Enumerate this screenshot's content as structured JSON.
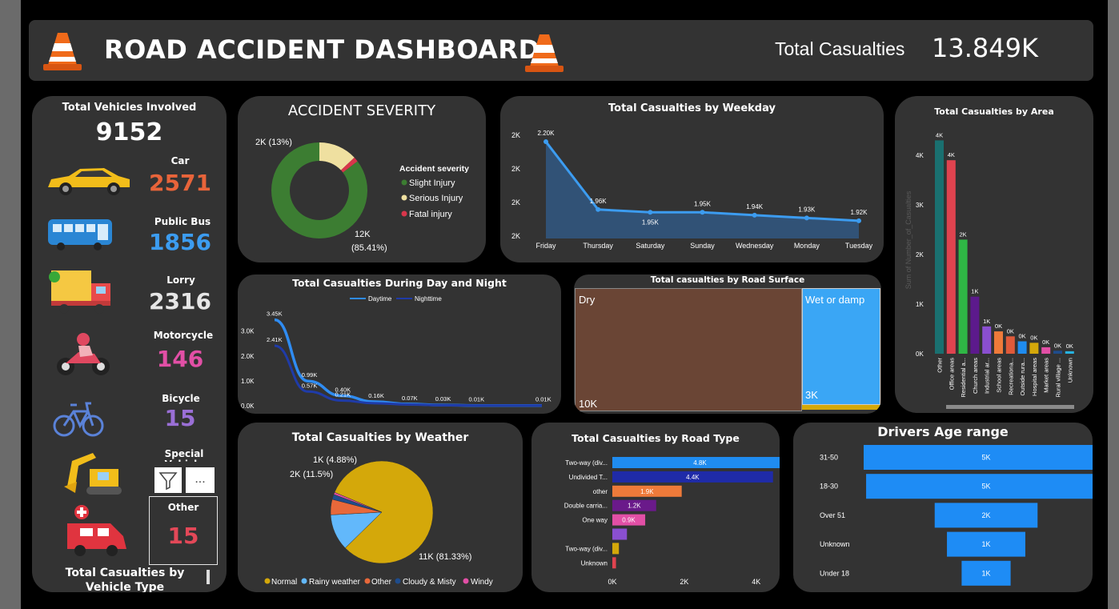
{
  "header": {
    "title": "ROAD ACCIDENT DASHBOARD",
    "kpi_label": "Total Casualties",
    "kpi_value": "13.849K"
  },
  "vehicles": {
    "title": "Total Vehicles Involved",
    "total": "9152",
    "items": [
      {
        "label": "Car",
        "value": "2571",
        "color": "#e8643a"
      },
      {
        "label": "Public Bus",
        "value": "1856",
        "color": "#3c9cf0"
      },
      {
        "label": "Lorry",
        "value": "2316",
        "color": "#e6e6e6"
      },
      {
        "label": "Motorcycle",
        "value": "146",
        "color": "#e24fa6"
      },
      {
        "label": "Bicycle",
        "value": "15",
        "color": "#9a6fd6"
      },
      {
        "label": "Special Vehicle",
        "value": ""
      },
      {
        "label": "Other",
        "value": "15",
        "color": "#e34858"
      }
    ],
    "footer": "Total Casualties by Vehicle Type"
  },
  "severity": {
    "title": "ACCIDENT SEVERITY",
    "legend_title": "Accident severity",
    "legend": [
      {
        "name": "Slight Injury",
        "color": "#3c7d32"
      },
      {
        "name": "Serious Injury",
        "color": "#efe0a0"
      },
      {
        "name": "Fatal injury",
        "color": "#d8364b"
      }
    ],
    "label_serious": "2K (13%)",
    "label_slight_1": "12K",
    "label_slight_2": "(85.41%)"
  },
  "weekday": {
    "title": "Total Casualties by Weekday"
  },
  "area": {
    "title": "Total Casualties by Area",
    "ylabel": "Sum of Number_of_Casualties"
  },
  "daynight": {
    "title": "Total Casualties During Day and Night",
    "legend": [
      "Daytime",
      "Nighttime"
    ]
  },
  "surface": {
    "title": "Total casualties by Road Surface",
    "dry_label": "Dry",
    "dry_value": "10K",
    "wet_label": "Wet or damp",
    "wet_value": "3K"
  },
  "weather": {
    "title": "Total Casualties by Weather",
    "label_normal": "11K (81.33%)",
    "label_rainy": "2K (11.5%)",
    "label_other": "1K (4.88%)",
    "legend": [
      {
        "name": "Normal",
        "color": "#d4a80a"
      },
      {
        "name": "Rainy weather",
        "color": "#62b8fb"
      },
      {
        "name": "Other",
        "color": "#e8683a"
      },
      {
        "name": "Cloudy & Misty",
        "color": "#1f4c8c"
      },
      {
        "name": "Windy",
        "color": "#e24fa6"
      }
    ]
  },
  "roadtype": {
    "title": "Total Casualties by Road Type"
  },
  "age": {
    "title": "Drivers Age range"
  },
  "toolbar": {
    "filter": "filter-icon",
    "more": "..."
  },
  "chart_data": [
    {
      "type": "area",
      "title": "Total Casualties by Weekday",
      "categories": [
        "Friday",
        "Thursday",
        "Saturday",
        "Sunday",
        "Wednesday",
        "Monday",
        "Tuesday"
      ],
      "values": [
        2.2,
        1.96,
        1.95,
        1.95,
        1.94,
        1.93,
        1.92
      ],
      "data_labels": [
        "2.20K",
        "1.96K",
        "1.95K",
        "1.95K",
        "1.94K",
        "1.93K",
        "1.92K"
      ],
      "ytick_labels": [
        "2K",
        "2K",
        "2K",
        "2K"
      ],
      "color": "#3c9cf0"
    },
    {
      "type": "bar",
      "title": "Total Casualties by Area",
      "categories": [
        "Other",
        "Office areas",
        "Residential a...",
        "Church areas",
        "Industrial ar...",
        "School areas",
        "Recreationa...",
        "Outside rura...",
        "Hospital areas",
        "Market areas",
        "Rural village ...",
        "Unknown"
      ],
      "values": [
        4.3,
        3.9,
        2.3,
        1.15,
        0.55,
        0.45,
        0.35,
        0.25,
        0.22,
        0.13,
        0.06,
        0.05
      ],
      "data_labels": [
        "4K",
        "4K",
        "2K",
        "1K",
        "1K",
        "0K",
        "0K",
        "0K",
        "0K",
        "0K",
        "0K",
        "0K"
      ],
      "colors": [
        "#1a7070",
        "#e0434f",
        "#2fb745",
        "#5c1a8c",
        "#8a4fd0",
        "#ee7a3a",
        "#e05a3a",
        "#1f8cf0",
        "#d4a80a",
        "#e24fa6",
        "#1f4c8c",
        "#27b3e0",
        "#8a4fd0"
      ],
      "yticks": [
        "0K",
        "1K",
        "2K",
        "3K",
        "4K"
      ],
      "ylim": [
        0,
        4.5
      ]
    },
    {
      "type": "line",
      "title": "Total Casualties During Day and Night",
      "x_count": 9,
      "series": [
        {
          "name": "Daytime",
          "values": [
            3.45,
            0.99,
            0.4,
            0.16,
            0.07,
            0.03,
            0.01,
            0.01,
            0.01
          ],
          "color": "#2f8cf2"
        },
        {
          "name": "Nighttime",
          "values": [
            2.41,
            0.57,
            0.21,
            0.1,
            0.05,
            0.02,
            0.01,
            0.01,
            0.01
          ],
          "color": "#1f3ba8"
        }
      ],
      "data_labels": [
        {
          "text": "3.45K",
          "i": 0,
          "v": 3.45
        },
        {
          "text": "2.41K",
          "i": 0,
          "v": 2.41
        },
        {
          "text": "0.99K",
          "i": 1,
          "v": 0.99
        },
        {
          "text": "0.57K",
          "i": 1,
          "v": 0.57
        },
        {
          "text": "0.40K",
          "i": 2,
          "v": 0.4
        },
        {
          "text": "0.21K",
          "i": 2,
          "v": 0.21
        },
        {
          "text": "0.16K",
          "i": 3,
          "v": 0.16
        },
        {
          "text": "0.07K",
          "i": 4,
          "v": 0.07
        },
        {
          "text": "0.03K",
          "i": 5,
          "v": 0.03
        },
        {
          "text": "0.01K",
          "i": 6,
          "v": 0.01
        },
        {
          "text": "0.01K",
          "i": 8,
          "v": 0.01
        }
      ],
      "yticks": [
        "0.0K",
        "1.0K",
        "2.0K",
        "3.0K"
      ],
      "ylim": [
        0,
        3.6
      ]
    },
    {
      "type": "pie",
      "title": "Total Casualties by Weather",
      "labels": [
        "Normal",
        "Rainy weather",
        "Other",
        "Cloudy & Misty",
        "Windy"
      ],
      "values": [
        81.33,
        11.5,
        4.88,
        1.6,
        0.69
      ],
      "colors": [
        "#d4a80a",
        "#62b8fb",
        "#e8683a",
        "#1f4c8c",
        "#e24fa6"
      ]
    },
    {
      "type": "donut",
      "title": "ACCIDENT SEVERITY",
      "labels": [
        "Slight Injury",
        "Serious Injury",
        "Fatal injury"
      ],
      "values": [
        85.41,
        13.0,
        1.59
      ],
      "colors": [
        "#3c7d32",
        "#efe0a0",
        "#d8364b"
      ]
    },
    {
      "type": "bar",
      "title": "Total Casualties by Road Type",
      "orientation": "horizontal",
      "categories": [
        "Two-way (div...",
        "Undivided T...",
        "other",
        "Double carria...",
        "One way",
        "",
        "Two-way (div...",
        "Unknown"
      ],
      "values": [
        4.8,
        4.4,
        1.9,
        1.2,
        0.9,
        0.4,
        0.18,
        0.1
      ],
      "data_labels": [
        "4.8K",
        "4.4K",
        "1.9K",
        "1.2K",
        "0.9K",
        "",
        "",
        ""
      ],
      "colors": [
        "#1f8cf0",
        "#1f2ba8",
        "#ee7a3a",
        "#6a1a8a",
        "#e24fa6",
        "#8a4fd0",
        "#d4a80a",
        "#e0434f"
      ],
      "xticks": [
        "0K",
        "2K",
        "4K"
      ],
      "xlim": [
        0,
        5
      ]
    },
    {
      "type": "bar",
      "title": "Drivers Age range",
      "orientation": "funnel",
      "categories": [
        "31-50",
        "18-30",
        "Over 51",
        "Unknown",
        "Under 18"
      ],
      "values": [
        5.0,
        4.9,
        2.1,
        1.6,
        1.0
      ],
      "data_labels": [
        "5K",
        "5K",
        "2K",
        "1K",
        "1K"
      ],
      "color": "#1e8cf5"
    }
  ]
}
